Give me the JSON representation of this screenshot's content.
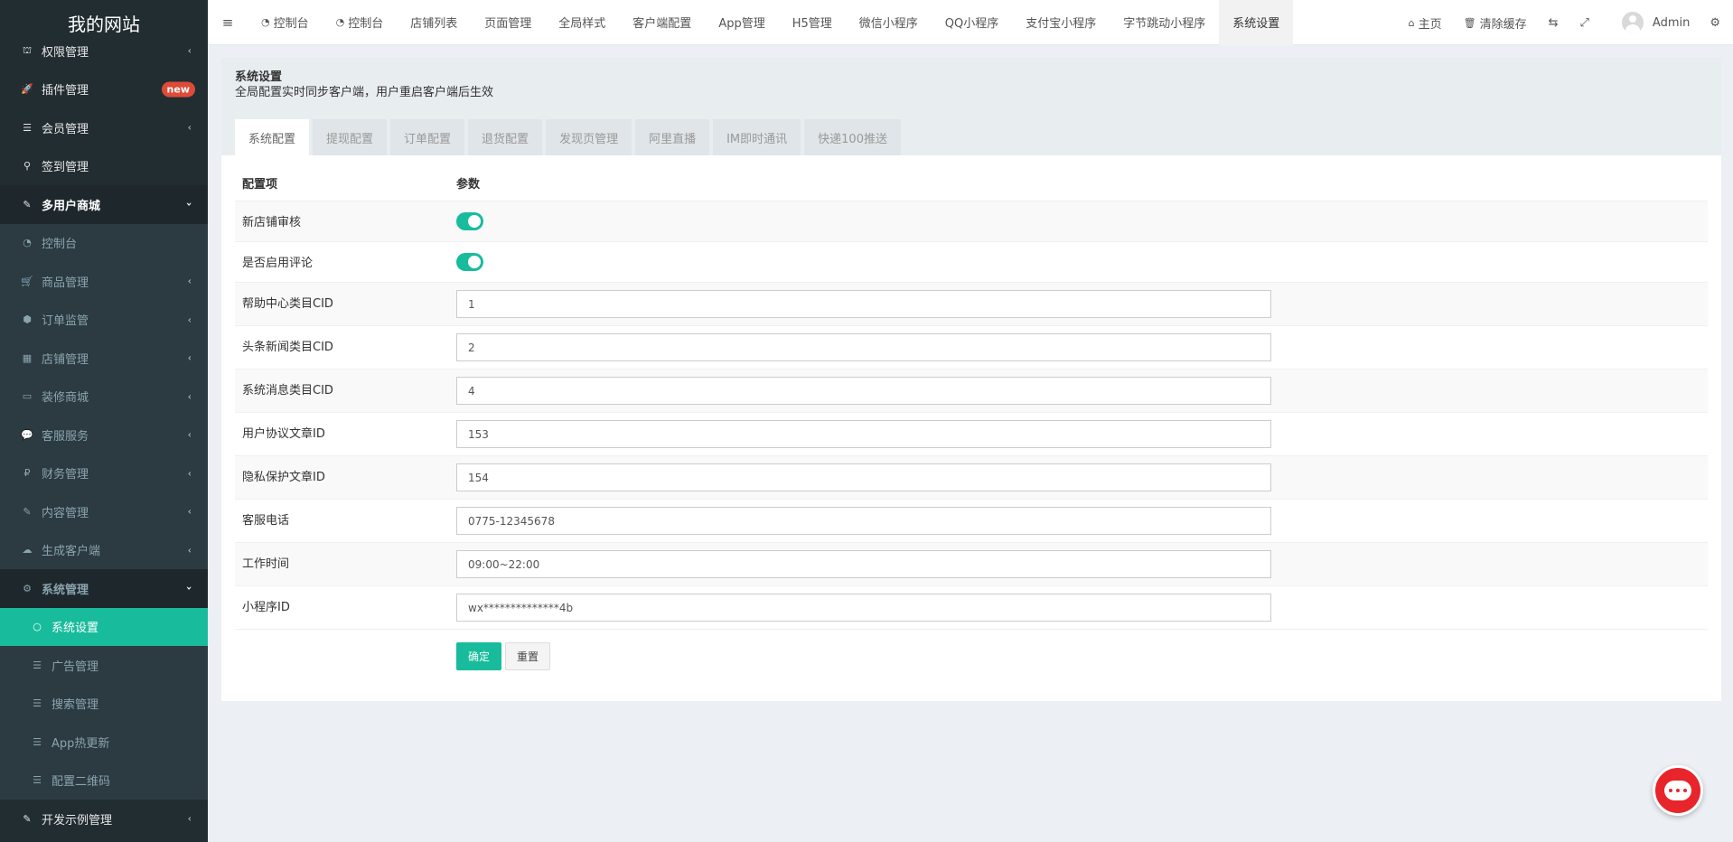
{
  "sidebar": {
    "logo": "我的网站",
    "items": [
      {
        "label": "权限管理",
        "icon": "⛫",
        "icon_name": "group-icon",
        "arrow": "‹"
      },
      {
        "label": "插件管理",
        "icon": "🚀",
        "icon_name": "rocket-icon",
        "badge": "new"
      },
      {
        "label": "会员管理",
        "icon": "☰",
        "icon_name": "list-icon",
        "arrow": "‹"
      },
      {
        "label": "签到管理",
        "icon": "⚲",
        "icon_name": "map-marker-icon"
      },
      {
        "label": "多用户商城",
        "icon": "✎",
        "icon_name": "magic-icon",
        "arrow": "›"
      }
    ],
    "shop_sub": [
      {
        "label": "控制台",
        "icon": "◔",
        "icon_name": "dashboard-icon"
      },
      {
        "label": "商品管理",
        "icon": "🛒",
        "icon_name": "cart-icon",
        "arrow": "‹"
      },
      {
        "label": "订单监管",
        "icon": "⬢",
        "icon_name": "cube-icon",
        "arrow": "‹"
      },
      {
        "label": "店铺管理",
        "icon": "▦",
        "icon_name": "building-icon",
        "arrow": "‹"
      },
      {
        "label": "装修商城",
        "icon": "▭",
        "icon_name": "desktop-icon",
        "arrow": "‹"
      },
      {
        "label": "客服服务",
        "icon": "💬",
        "icon_name": "comments-icon",
        "arrow": "‹"
      },
      {
        "label": "财务管理",
        "icon": "₽",
        "icon_name": "money-icon",
        "arrow": "‹"
      },
      {
        "label": "内容管理",
        "icon": "✎",
        "icon_name": "edit-icon",
        "arrow": "‹"
      },
      {
        "label": "生成客户端",
        "icon": "☁",
        "icon_name": "cloud-icon",
        "arrow": "‹"
      },
      {
        "label": "系统管理",
        "icon": "⚙",
        "icon_name": "cog-icon",
        "arrow": "›"
      }
    ],
    "system_sub": [
      {
        "label": "系统设置",
        "icon": "○",
        "icon_name": "circle-icon"
      },
      {
        "label": "广告管理",
        "icon": "☰",
        "icon_name": "list-icon"
      },
      {
        "label": "搜索管理",
        "icon": "☰",
        "icon_name": "list-icon"
      },
      {
        "label": "App热更新",
        "icon": "☰",
        "icon_name": "list-icon"
      },
      {
        "label": "配置二维码",
        "icon": "☰",
        "icon_name": "list-icon"
      }
    ],
    "bottom": {
      "label": "开发示例管理",
      "icon": "✎",
      "icon_name": "magic-icon",
      "arrow": "‹"
    }
  },
  "navbar": {
    "toggle_icon": "≡",
    "tabs": [
      {
        "label": "控制台",
        "icon": "◔"
      },
      {
        "label": "控制台",
        "icon": "◔"
      },
      {
        "label": "店铺列表"
      },
      {
        "label": "页面管理"
      },
      {
        "label": "全局样式"
      },
      {
        "label": "客户端配置"
      },
      {
        "label": "App管理"
      },
      {
        "label": "H5管理"
      },
      {
        "label": "微信小程序"
      },
      {
        "label": "QQ小程序"
      },
      {
        "label": "支付宝小程序"
      },
      {
        "label": "字节跳动小程序"
      },
      {
        "label": "系统设置"
      }
    ],
    "home_label": "主页",
    "home_icon": "⌂",
    "clear_label": "清除缓存",
    "clear_icon": "🗑",
    "translate_icon": "⇆",
    "fullscreen_icon": "⤢",
    "user_name": "Admin",
    "settings_icon": "⚙"
  },
  "panel": {
    "title": "系统设置",
    "desc": "全局配置实时同步客户端，用户重启客户端后生效",
    "tabs": [
      "系统配置",
      "提现配置",
      "订单配置",
      "退货配置",
      "发现页管理",
      "阿里直播",
      "IM即时通讯",
      "快递100推送"
    ],
    "col_label": "配置项",
    "col_value": "参数",
    "switches": [
      {
        "label": "新店铺审核",
        "on": true
      },
      {
        "label": "是否启用评论",
        "on": true
      }
    ],
    "fields": [
      {
        "label": "帮助中心类目CID",
        "value": "1"
      },
      {
        "label": "头条新闻类目CID",
        "value": "2"
      },
      {
        "label": "系统消息类目CID",
        "value": "4"
      },
      {
        "label": "用户协议文章ID",
        "value": "153"
      },
      {
        "label": "隐私保护文章ID",
        "value": "154"
      },
      {
        "label": "客服电话",
        "value": "0775-12345678"
      },
      {
        "label": "工作时间",
        "value": "09:00~22:00"
      },
      {
        "label": "小程序ID",
        "value": "wx**************4b"
      }
    ],
    "submit_label": "确定",
    "reset_label": "重置"
  },
  "colors": {
    "accent": "#18bc9c",
    "sidebar": "#222d32",
    "badge": "#dd4b39",
    "chat": "#e8252b"
  }
}
